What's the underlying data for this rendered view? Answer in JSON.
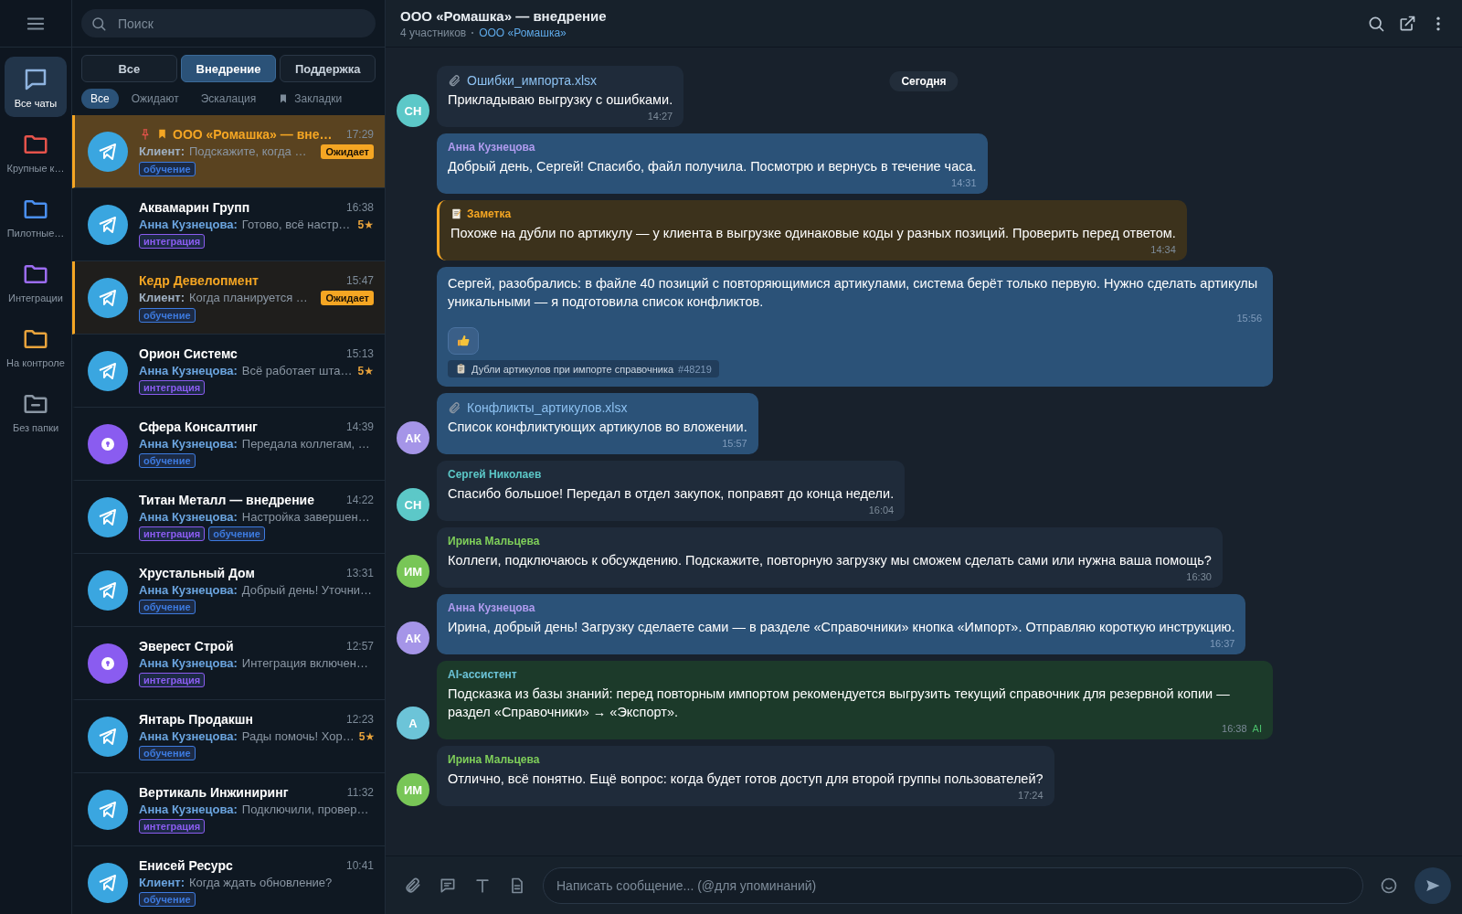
{
  "rail": {
    "items": [
      {
        "kind": "chats",
        "label": "Все чаты",
        "selected": true,
        "color": "#8fb4e0"
      },
      {
        "kind": "folder",
        "label": "Крупные к…",
        "selected": false,
        "color": "#e5534b"
      },
      {
        "kind": "folder",
        "label": "Пилотные…",
        "selected": false,
        "color": "#4a8ff0"
      },
      {
        "kind": "folder",
        "label": "Интеграции",
        "selected": false,
        "color": "#9b6cf0"
      },
      {
        "kind": "folder",
        "label": "На контроле",
        "selected": false,
        "color": "#e8a33c"
      },
      {
        "kind": "folder-minus",
        "label": "Без папки",
        "selected": false,
        "color": "#8a96a3"
      }
    ]
  },
  "search": {
    "placeholder": "Поиск"
  },
  "tabs": [
    {
      "label": "Все",
      "selected": false
    },
    {
      "label": "Внедрение",
      "selected": true
    },
    {
      "label": "Поддержка",
      "selected": false
    }
  ],
  "filters": [
    {
      "label": "Все",
      "kind": "plain",
      "selected": true
    },
    {
      "label": "Ожидают",
      "kind": "plain",
      "selected": false
    },
    {
      "label": "Эскалация",
      "kind": "plain",
      "selected": false
    },
    {
      "label": "Закладки",
      "kind": "bookmark",
      "selected": false
    }
  ],
  "chats": [
    {
      "name": "ООО «Ромашка» — вне…",
      "time": "17:29",
      "sender": "Клиент:",
      "preview": "Подскажите, когда …",
      "kind": "plane",
      "selected": true,
      "pending": true,
      "pinned": true,
      "bookmarked": true,
      "status": "Ожидает",
      "tags": [
        {
          "label": "обучение",
          "color": "#3d7be0"
        }
      ]
    },
    {
      "name": "Аквамарин Групп",
      "time": "16:38",
      "sender": "Анна Кузнецова:",
      "preview": "Готово, всё настр…",
      "kind": "plane",
      "selected": false,
      "pending": false,
      "pinned": false,
      "bookmarked": false,
      "rating": "5★",
      "tags": [
        {
          "label": "интеграция",
          "color": "#8a5cf0"
        }
      ]
    },
    {
      "name": "Кедр Девелопмент",
      "time": "15:47",
      "sender": "Клиент:",
      "preview": "Когда планируется …",
      "kind": "plane",
      "selected": false,
      "pending": true,
      "pinned": false,
      "bookmarked": false,
      "status": "Ожидает",
      "tags": [
        {
          "label": "обучение",
          "color": "#3d7be0"
        }
      ]
    },
    {
      "name": "Орион Системс",
      "time": "15:13",
      "sender": "Анна Кузнецова:",
      "preview": "Всё работает шта…",
      "kind": "plane",
      "selected": false,
      "pending": false,
      "pinned": false,
      "bookmarked": false,
      "rating": "5★",
      "tags": [
        {
          "label": "интеграция",
          "color": "#8a5cf0"
        }
      ]
    },
    {
      "name": "Сфера Консалтинг",
      "time": "14:39",
      "sender": "Анна Кузнецова:",
      "preview": "Передала коллегам, …",
      "kind": "bubble",
      "selected": false,
      "pending": false,
      "pinned": false,
      "bookmarked": false,
      "tags": [
        {
          "label": "обучение",
          "color": "#3d7be0"
        }
      ]
    },
    {
      "name": "Титан Металл — внедрение",
      "time": "14:22",
      "sender": "Анна Кузнецова:",
      "preview": "Настройка завершен…",
      "kind": "plane",
      "selected": false,
      "pending": false,
      "pinned": false,
      "bookmarked": false,
      "tags": [
        {
          "label": "интеграция",
          "color": "#8a5cf0"
        },
        {
          "label": "обучение",
          "color": "#3d7be0"
        }
      ]
    },
    {
      "name": "Хрустальный Дом",
      "time": "13:31",
      "sender": "Анна Кузнецова:",
      "preview": "Добрый день! Уточни…",
      "kind": "plane",
      "selected": false,
      "pending": false,
      "pinned": false,
      "bookmarked": false,
      "tags": [
        {
          "label": "обучение",
          "color": "#3d7be0"
        }
      ]
    },
    {
      "name": "Эверест Строй",
      "time": "12:57",
      "sender": "Анна Кузнецова:",
      "preview": "Интеграция включен…",
      "kind": "bubble",
      "selected": false,
      "pending": false,
      "pinned": false,
      "bookmarked": false,
      "tags": [
        {
          "label": "интеграция",
          "color": "#8a5cf0"
        }
      ]
    },
    {
      "name": "Янтарь Продакшн",
      "time": "12:23",
      "sender": "Анна Кузнецова:",
      "preview": "Рады помочь! Хор…",
      "kind": "plane",
      "selected": false,
      "pending": false,
      "pinned": false,
      "bookmarked": false,
      "rating": "5★",
      "tags": [
        {
          "label": "обучение",
          "color": "#3d7be0"
        }
      ]
    },
    {
      "name": "Вертикаль Инжиниринг",
      "time": "11:32",
      "sender": "Анна Кузнецова:",
      "preview": "Подключили, провер…",
      "kind": "plane",
      "selected": false,
      "pending": false,
      "pinned": false,
      "bookmarked": false,
      "tags": [
        {
          "label": "интеграция",
          "color": "#8a5cf0"
        }
      ]
    },
    {
      "name": "Енисей Ресурс",
      "time": "10:41",
      "sender": "Клиент:",
      "preview": "Когда ждать обновление?",
      "kind": "plane",
      "selected": false,
      "pending": false,
      "pinned": false,
      "bookmarked": false,
      "tags": [
        {
          "label": "обучение",
          "color": "#3d7be0"
        }
      ]
    }
  ],
  "chat_header": {
    "title": "ООО «Ромашка» — внедрение",
    "members": "4 участников",
    "company": "ООО «Ромашка»"
  },
  "date_pill": "Сегодня",
  "messages": [
    {
      "kind": "incoming",
      "attachment": "Ошибки_импорта.xlsx",
      "text": "Прикладываю выгрузку с ошибками.",
      "time": "14:27",
      "avatar": {
        "initials": "СН",
        "color": "#5cc8c8"
      }
    },
    {
      "kind": "outgoing",
      "sender": "Анна Кузнецова",
      "color": "#b19cf0",
      "text": "Добрый день, Сергей! Спасибо, файл получила. Посмотрю и вернусь в течение часа.",
      "time": "14:31"
    },
    {
      "kind": "note",
      "sender": "Заметка",
      "color": "#f5a623",
      "text": "Похоже на дубли по артикулу — у клиента в выгрузке одинаковые коды у разных позиций. Проверить перед ответом.",
      "time": "14:34"
    },
    {
      "kind": "outgoing",
      "text": "Сергей, разобрались: в файле 40 позиций с повторяющимися артикулами, система берёт только первую. Нужно сделать артикулы уникальными — я подготовила список конфликтов.",
      "time": "15:56",
      "reacted": true,
      "ticket": {
        "title": "Дубли артикулов при импорте справочника",
        "number": "#48219"
      }
    },
    {
      "kind": "outgoing",
      "attachment": "Конфликты_артикулов.xlsx",
      "text": "Список конфликтующих артикулов во вложении.",
      "time": "15:57",
      "avatar": {
        "initials": "АК",
        "color": "#a595e8"
      }
    },
    {
      "kind": "incoming",
      "sender": "Сергей Николаев",
      "color": "#5cc8c8",
      "text": "Спасибо большое! Передал в отдел закупок, поправят до конца недели.",
      "time": "16:04",
      "avatar": {
        "initials": "СН",
        "color": "#5cc8c8"
      }
    },
    {
      "kind": "incoming",
      "sender": "Ирина Мальцева",
      "color": "#7fcf5a",
      "text": "Коллеги, подключаюсь к обсуждению. Подскажите, повторную загрузку мы сможем сделать сами или нужна ваша помощь?",
      "time": "16:30",
      "avatar": {
        "initials": "ИМ",
        "color": "#78c657"
      }
    },
    {
      "kind": "outgoing",
      "sender": "Анна Кузнецова",
      "color": "#b19cf0",
      "text": "Ирина, добрый день! Загрузку сделаете сами — в разделе «Справочники» кнопка «Импорт». Отправляю короткую инструкцию.",
      "time": "16:37",
      "avatar": {
        "initials": "АК",
        "color": "#a595e8"
      }
    },
    {
      "kind": "ai",
      "sender": "AI-ассистент",
      "color": "#6cc4d8",
      "text": "Подсказка из базы знаний: перед повторным импортом рекомендуется выгрузить текущий справочник для резервной копии — раздел «Справочники» → «Экспорт».",
      "time": "16:38",
      "badge": "AI",
      "avatar": {
        "initials": "А",
        "color": "#6cc4d8"
      }
    },
    {
      "kind": "incoming",
      "sender": "Ирина Мальцева",
      "color": "#7fcf5a",
      "text": "Отлично, всё понятно. Ещё вопрос: когда будет готов доступ для второй группы пользователей?",
      "time": "17:24",
      "avatar": {
        "initials": "ИМ",
        "color": "#78c657"
      }
    }
  ],
  "composer": {
    "placeholder": "Написать сообщение... (@для упоминаний)"
  }
}
